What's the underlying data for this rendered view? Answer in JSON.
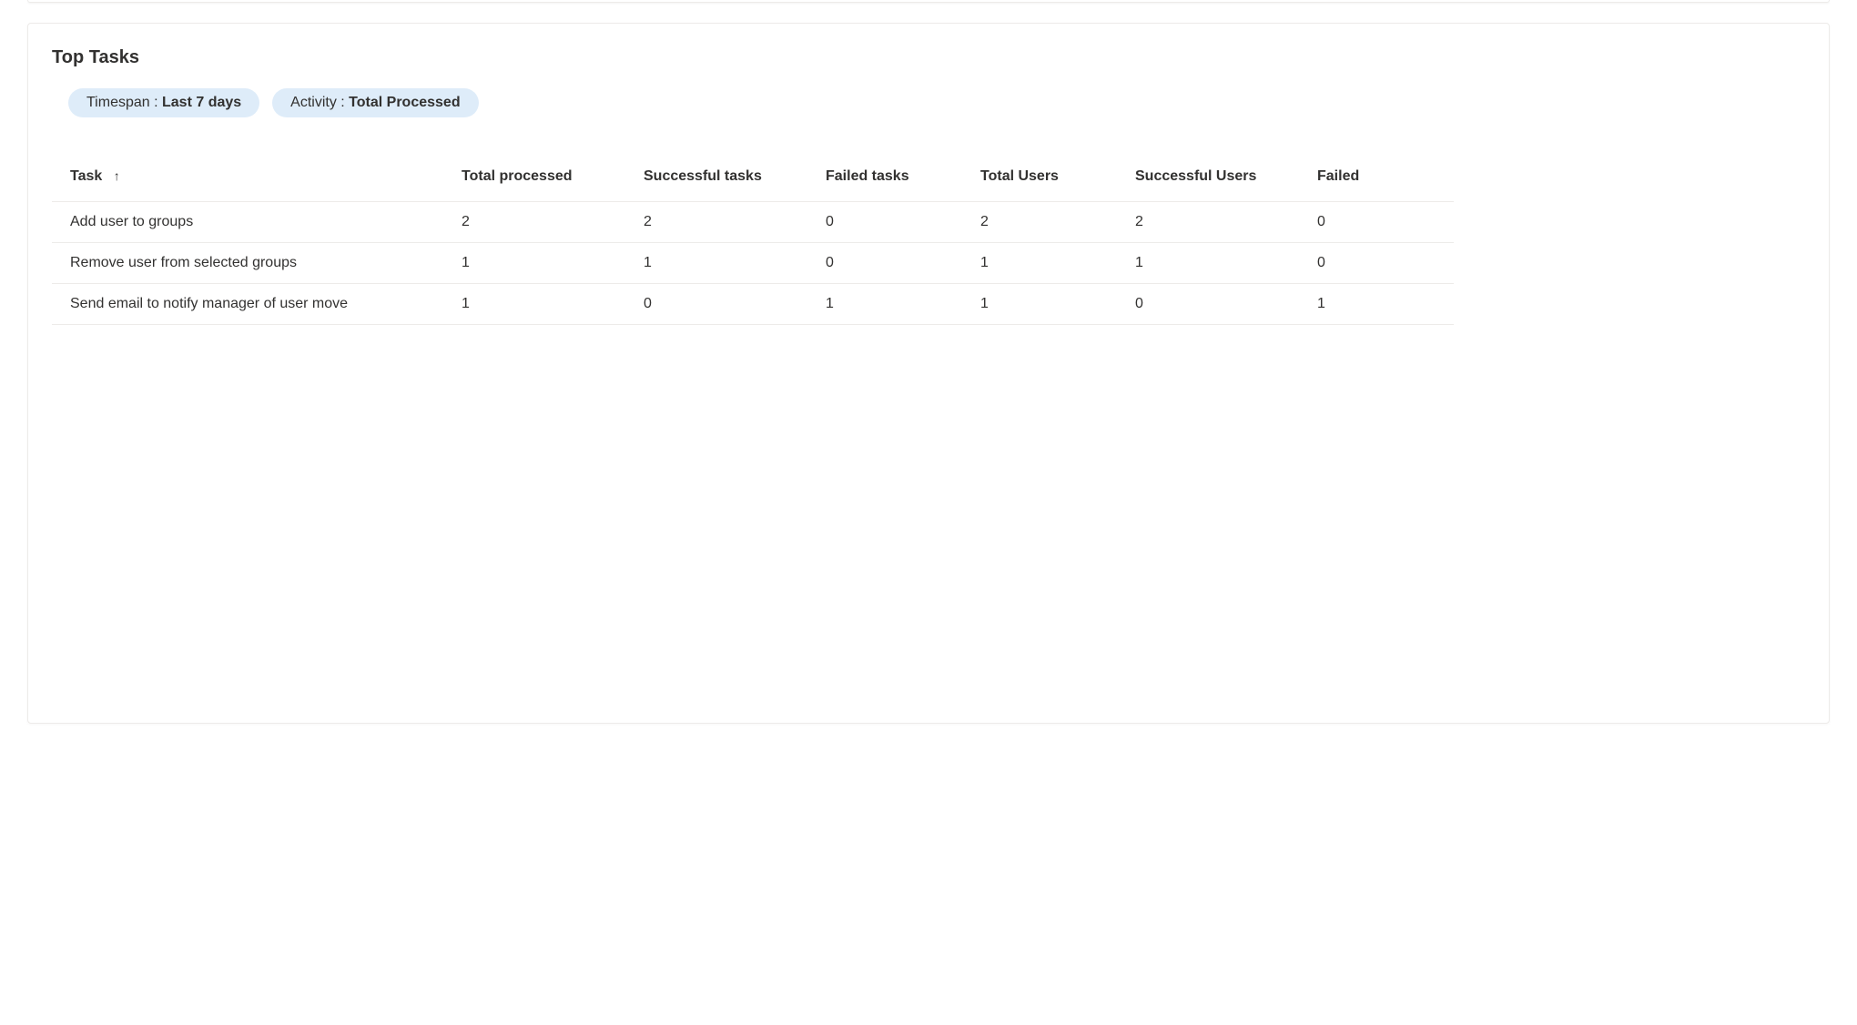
{
  "card": {
    "title": "Top Tasks"
  },
  "filters": {
    "timespan": {
      "label": "Timespan : ",
      "value": "Last 7 days"
    },
    "activity": {
      "label": "Activity : ",
      "value": "Total Processed"
    }
  },
  "table": {
    "columns": {
      "task": "Task",
      "total_processed": "Total processed",
      "successful_tasks": "Successful tasks",
      "failed_tasks": "Failed tasks",
      "total_users": "Total Users",
      "successful_users": "Successful Users",
      "failed": "Failed"
    },
    "sort_icon": "↑",
    "rows": [
      {
        "task": "Add user to groups",
        "total_processed": "2",
        "successful_tasks": "2",
        "failed_tasks": "0",
        "total_users": "2",
        "successful_users": "2",
        "failed": "0"
      },
      {
        "task": "Remove user from selected groups",
        "total_processed": "1",
        "successful_tasks": "1",
        "failed_tasks": "0",
        "total_users": "1",
        "successful_users": "1",
        "failed": "0"
      },
      {
        "task": "Send email to notify manager of user move",
        "total_processed": "1",
        "successful_tasks": "0",
        "failed_tasks": "1",
        "total_users": "1",
        "successful_users": "0",
        "failed": "1"
      }
    ]
  }
}
